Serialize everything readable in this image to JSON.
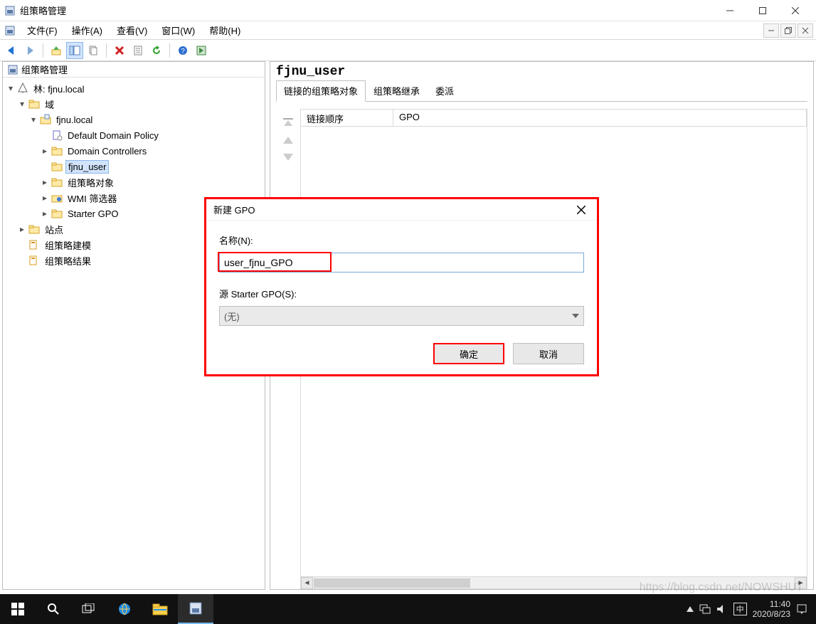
{
  "window": {
    "title": "组策略管理"
  },
  "menu": {
    "items": [
      "文件(F)",
      "操作(A)",
      "查看(V)",
      "窗口(W)",
      "帮助(H)"
    ]
  },
  "toolbar": {
    "tips": [
      "后退",
      "前进",
      "上一级",
      "显示/隐藏控制台树",
      "复制",
      "删除",
      "属性",
      "刷新",
      "帮助",
      "保存"
    ]
  },
  "tree": {
    "root": "组策略管理",
    "forest": "林: fjnu.local",
    "domains": "域",
    "domain": "fjnu.local",
    "ddp": "Default Domain Policy",
    "dc": "Domain Controllers",
    "ou": "fjnu_user",
    "gpo": "组策略对象",
    "wmi": "WMI 筛选器",
    "starter": "Starter GPO",
    "sites": "站点",
    "modeling": "组策略建模",
    "results": "组策略结果"
  },
  "detail": {
    "title": "fjnu_user",
    "tabs": [
      "链接的组策略对象",
      "组策略继承",
      "委派"
    ],
    "columns": [
      "链接顺序",
      "GPO"
    ]
  },
  "dialog": {
    "title": "新建 GPO",
    "name_label": "名称(N):",
    "name_value": "user_fjnu_GPO",
    "src_label": "源 Starter GPO(S):",
    "src_value": "(无)",
    "ok": "确定",
    "cancel": "取消"
  },
  "taskbar": {
    "time": "11:40",
    "date": "2020/8/23"
  },
  "watermark": "https://blog.csdn.net/NOWSHUT"
}
